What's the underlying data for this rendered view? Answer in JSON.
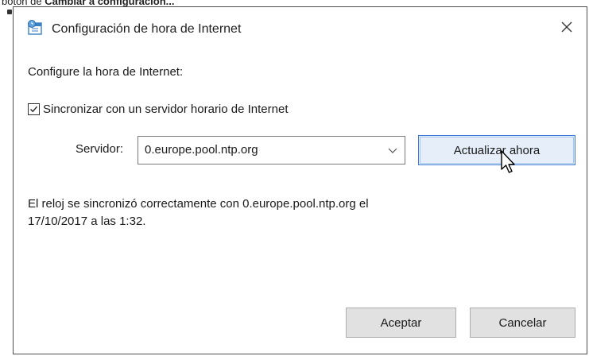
{
  "caption": {
    "prefix": "botón de ",
    "bold": "Cambiar a configuración..."
  },
  "dialog": {
    "title": "Configuración de hora de Internet",
    "heading": "Configure la hora de Internet:",
    "sync_checkbox": {
      "label": "Sincronizar con un servidor horario de Internet",
      "checked": true
    },
    "server": {
      "label": "Servidor:",
      "value": "0.europe.pool.ntp.org"
    },
    "update_button": "Actualizar ahora",
    "status_line1": "El reloj se sincronizó correctamente con 0.europe.pool.ntp.org el",
    "status_line2": "17/10/2017 a las 1:32.",
    "ok_button": "Aceptar",
    "cancel_button": "Cancelar"
  },
  "icons": {
    "app": "date-time-icon",
    "close": "close-icon",
    "dropdown": "chevron-down-icon",
    "check": "checkmark-icon",
    "cursor": "mouse-pointer-icon"
  },
  "colors": {
    "accent_border": "#3a7bd5",
    "accent_fill": "#e5eef9",
    "button_fill": "#e1e1e1"
  }
}
